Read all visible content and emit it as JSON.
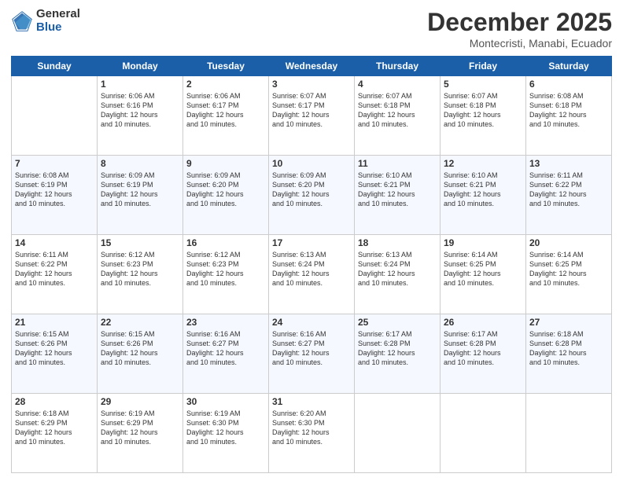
{
  "header": {
    "logo_general": "General",
    "logo_blue": "Blue",
    "month_title": "December 2025",
    "subtitle": "Montecristi, Manabi, Ecuador"
  },
  "days_of_week": [
    "Sunday",
    "Monday",
    "Tuesday",
    "Wednesday",
    "Thursday",
    "Friday",
    "Saturday"
  ],
  "weeks": [
    [
      {
        "day": "",
        "info": ""
      },
      {
        "day": "1",
        "info": "Sunrise: 6:06 AM\nSunset: 6:16 PM\nDaylight: 12 hours\nand 10 minutes."
      },
      {
        "day": "2",
        "info": "Sunrise: 6:06 AM\nSunset: 6:17 PM\nDaylight: 12 hours\nand 10 minutes."
      },
      {
        "day": "3",
        "info": "Sunrise: 6:07 AM\nSunset: 6:17 PM\nDaylight: 12 hours\nand 10 minutes."
      },
      {
        "day": "4",
        "info": "Sunrise: 6:07 AM\nSunset: 6:18 PM\nDaylight: 12 hours\nand 10 minutes."
      },
      {
        "day": "5",
        "info": "Sunrise: 6:07 AM\nSunset: 6:18 PM\nDaylight: 12 hours\nand 10 minutes."
      },
      {
        "day": "6",
        "info": "Sunrise: 6:08 AM\nSunset: 6:18 PM\nDaylight: 12 hours\nand 10 minutes."
      }
    ],
    [
      {
        "day": "7",
        "info": "Sunrise: 6:08 AM\nSunset: 6:19 PM\nDaylight: 12 hours\nand 10 minutes."
      },
      {
        "day": "8",
        "info": "Sunrise: 6:09 AM\nSunset: 6:19 PM\nDaylight: 12 hours\nand 10 minutes."
      },
      {
        "day": "9",
        "info": "Sunrise: 6:09 AM\nSunset: 6:20 PM\nDaylight: 12 hours\nand 10 minutes."
      },
      {
        "day": "10",
        "info": "Sunrise: 6:09 AM\nSunset: 6:20 PM\nDaylight: 12 hours\nand 10 minutes."
      },
      {
        "day": "11",
        "info": "Sunrise: 6:10 AM\nSunset: 6:21 PM\nDaylight: 12 hours\nand 10 minutes."
      },
      {
        "day": "12",
        "info": "Sunrise: 6:10 AM\nSunset: 6:21 PM\nDaylight: 12 hours\nand 10 minutes."
      },
      {
        "day": "13",
        "info": "Sunrise: 6:11 AM\nSunset: 6:22 PM\nDaylight: 12 hours\nand 10 minutes."
      }
    ],
    [
      {
        "day": "14",
        "info": "Sunrise: 6:11 AM\nSunset: 6:22 PM\nDaylight: 12 hours\nand 10 minutes."
      },
      {
        "day": "15",
        "info": "Sunrise: 6:12 AM\nSunset: 6:23 PM\nDaylight: 12 hours\nand 10 minutes."
      },
      {
        "day": "16",
        "info": "Sunrise: 6:12 AM\nSunset: 6:23 PM\nDaylight: 12 hours\nand 10 minutes."
      },
      {
        "day": "17",
        "info": "Sunrise: 6:13 AM\nSunset: 6:24 PM\nDaylight: 12 hours\nand 10 minutes."
      },
      {
        "day": "18",
        "info": "Sunrise: 6:13 AM\nSunset: 6:24 PM\nDaylight: 12 hours\nand 10 minutes."
      },
      {
        "day": "19",
        "info": "Sunrise: 6:14 AM\nSunset: 6:25 PM\nDaylight: 12 hours\nand 10 minutes."
      },
      {
        "day": "20",
        "info": "Sunrise: 6:14 AM\nSunset: 6:25 PM\nDaylight: 12 hours\nand 10 minutes."
      }
    ],
    [
      {
        "day": "21",
        "info": "Sunrise: 6:15 AM\nSunset: 6:26 PM\nDaylight: 12 hours\nand 10 minutes."
      },
      {
        "day": "22",
        "info": "Sunrise: 6:15 AM\nSunset: 6:26 PM\nDaylight: 12 hours\nand 10 minutes."
      },
      {
        "day": "23",
        "info": "Sunrise: 6:16 AM\nSunset: 6:27 PM\nDaylight: 12 hours\nand 10 minutes."
      },
      {
        "day": "24",
        "info": "Sunrise: 6:16 AM\nSunset: 6:27 PM\nDaylight: 12 hours\nand 10 minutes."
      },
      {
        "day": "25",
        "info": "Sunrise: 6:17 AM\nSunset: 6:28 PM\nDaylight: 12 hours\nand 10 minutes."
      },
      {
        "day": "26",
        "info": "Sunrise: 6:17 AM\nSunset: 6:28 PM\nDaylight: 12 hours\nand 10 minutes."
      },
      {
        "day": "27",
        "info": "Sunrise: 6:18 AM\nSunset: 6:28 PM\nDaylight: 12 hours\nand 10 minutes."
      }
    ],
    [
      {
        "day": "28",
        "info": "Sunrise: 6:18 AM\nSunset: 6:29 PM\nDaylight: 12 hours\nand 10 minutes."
      },
      {
        "day": "29",
        "info": "Sunrise: 6:19 AM\nSunset: 6:29 PM\nDaylight: 12 hours\nand 10 minutes."
      },
      {
        "day": "30",
        "info": "Sunrise: 6:19 AM\nSunset: 6:30 PM\nDaylight: 12 hours\nand 10 minutes."
      },
      {
        "day": "31",
        "info": "Sunrise: 6:20 AM\nSunset: 6:30 PM\nDaylight: 12 hours\nand 10 minutes."
      },
      {
        "day": "",
        "info": ""
      },
      {
        "day": "",
        "info": ""
      },
      {
        "day": "",
        "info": ""
      }
    ]
  ]
}
